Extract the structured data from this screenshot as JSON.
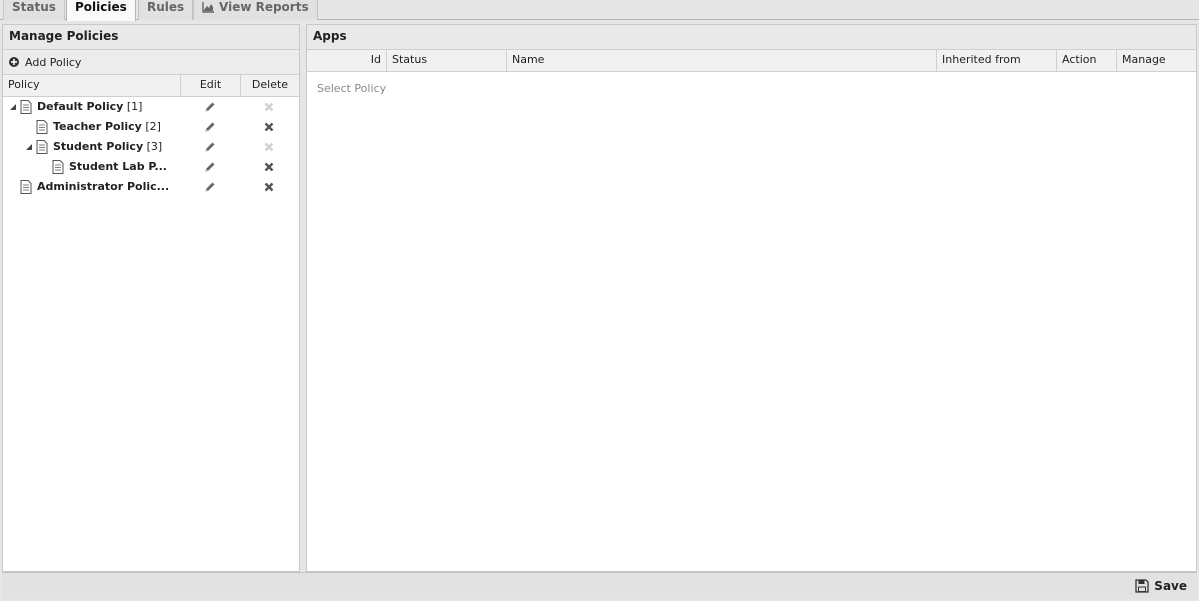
{
  "tabs": [
    {
      "label": "Status"
    },
    {
      "label": "Policies"
    },
    {
      "label": "Rules"
    },
    {
      "label": "View Reports",
      "icon": "chart-icon"
    }
  ],
  "left_panel": {
    "title": "Manage Policies",
    "add_label": "Add Policy",
    "columns": [
      "Policy",
      "Edit",
      "Delete"
    ],
    "policies": [
      {
        "name": "Default Policy",
        "id": "[1]",
        "depth": 0,
        "expanded": true,
        "deletable": false
      },
      {
        "name": "Teacher Policy",
        "id": "[2]",
        "depth": 1,
        "expanded": null,
        "deletable": true
      },
      {
        "name": "Student Policy",
        "id": "[3]",
        "depth": 1,
        "expanded": true,
        "deletable": false
      },
      {
        "name": "Student Lab P...",
        "id": "",
        "depth": 2,
        "expanded": null,
        "deletable": true
      },
      {
        "name": "Administrator Polic...",
        "id": "",
        "depth": 0,
        "expanded": null,
        "deletable": true
      }
    ]
  },
  "right_panel": {
    "title": "Apps",
    "columns": [
      "Id",
      "Status",
      "Name",
      "Inherited from",
      "Action",
      "Manage"
    ],
    "empty_text": "Select Policy"
  },
  "footer": {
    "save_label": "Save"
  },
  "colors": {
    "delete_enabled": "#555555",
    "delete_disabled": "#d0d0d0",
    "edit_icon": "#666666"
  }
}
